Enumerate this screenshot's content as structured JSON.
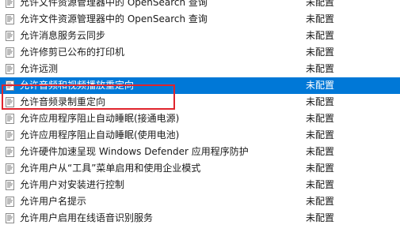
{
  "policies": [
    {
      "name": "允许文件资源管理器中的 OpenSearch 查询",
      "state": "未配置",
      "selected": false
    },
    {
      "name": "允许文件资源管理器中的 OpenSearch 查询",
      "state": "未配置",
      "selected": false
    },
    {
      "name": "允许消息服务云同步",
      "state": "未配置",
      "selected": false
    },
    {
      "name": "允许修剪已公布的打印机",
      "state": "未配置",
      "selected": false
    },
    {
      "name": "允许远测",
      "state": "未配置",
      "selected": false
    },
    {
      "name": "允许音频和视频播放重定向",
      "state": "未配置",
      "selected": true
    },
    {
      "name": "允许音频录制重定向",
      "state": "未配置",
      "selected": false
    },
    {
      "name": "允许应用程序阻止自动睡眠(接通电源)",
      "state": "未配置",
      "selected": false
    },
    {
      "name": "允许应用程序阻止自动睡眠(使用电池)",
      "state": "未配置",
      "selected": false
    },
    {
      "name": "允许硬件加速呈现 Windows Defender 应用程序防护",
      "state": "未配置",
      "selected": false
    },
    {
      "name": "允许用户从“工具”菜单启用和使用企业模式",
      "state": "未配置",
      "selected": false
    },
    {
      "name": "允许用户对安装进行控制",
      "state": "未配置",
      "selected": false
    },
    {
      "name": "允许用户名提示",
      "state": "未配置",
      "selected": false
    },
    {
      "name": "允许用户启用在线语音识别服务",
      "state": "未配置",
      "selected": false
    }
  ],
  "icon": "policy-setting-icon",
  "colors": {
    "selection": "#0078d7",
    "highlight_box": "#e0242c"
  }
}
